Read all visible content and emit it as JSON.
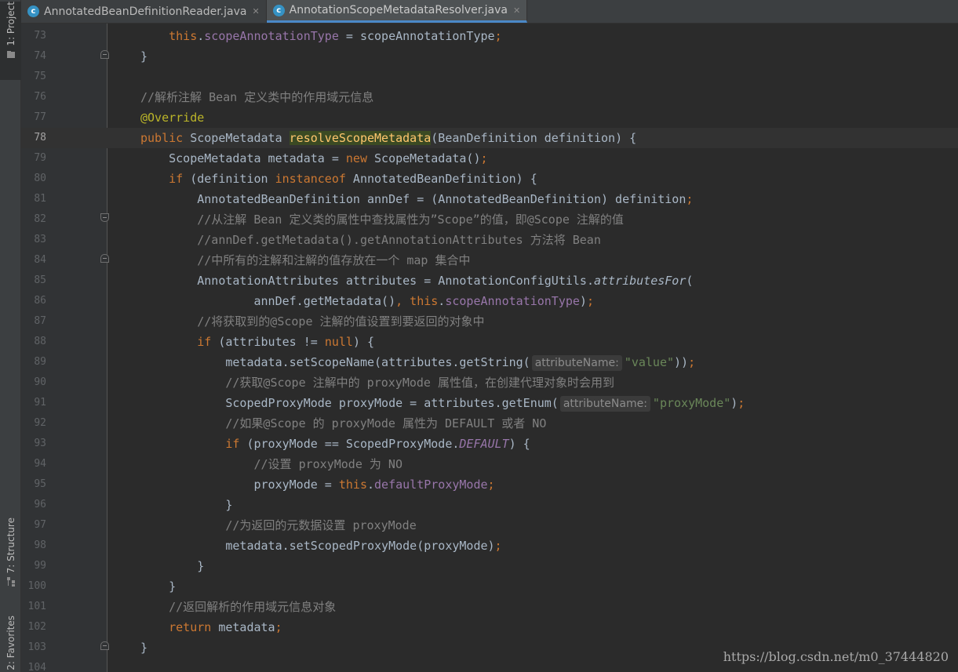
{
  "tool_windows": {
    "project": "1: Project",
    "structure": "7: Structure",
    "favorites": "2: Favorites"
  },
  "tabs": [
    {
      "icon": "class-icon",
      "label": "AnnotatedBeanDefinitionReader.java",
      "active": false
    },
    {
      "icon": "class-icon",
      "label": "AnnotationScopeMetadataResolver.java",
      "active": true
    }
  ],
  "editor": {
    "line_numbers": [
      "73",
      "74",
      "75",
      "76",
      "77",
      "78",
      "79",
      "80",
      "81",
      "82",
      "83",
      "84",
      "85",
      "86",
      "87",
      "88",
      "89",
      "90",
      "91",
      "92",
      "93",
      "94",
      "95",
      "96",
      "97",
      "98",
      "99",
      "100",
      "101",
      "102",
      "103",
      "104"
    ],
    "current_line": "78",
    "inlay_hints": {
      "line89": "attributeName:",
      "line91": "attributeName:"
    }
  },
  "watermark": "https://blog.csdn.net/m0_37444820",
  "colors": {
    "background": "#2b2b2b",
    "gutter": "#313335",
    "keyword": "#cc7832",
    "field": "#9876aa",
    "comment": "#808080",
    "annotation": "#bbb529",
    "string": "#6a8759",
    "accent": "#4a88c7"
  }
}
